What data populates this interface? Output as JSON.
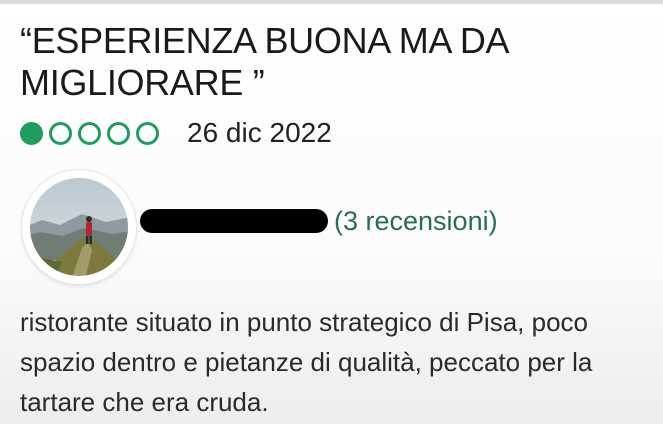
{
  "review": {
    "title": "“ESPERIENZA BUONA MA DA MIGLIORARE ”",
    "rating": {
      "value": 1,
      "max": 5,
      "color": "#1f9d5c"
    },
    "date": "26 dic 2022",
    "author": {
      "avatar_icon": "hiker-on-ridge-photo",
      "name_redacted": true,
      "review_count_label": "(3 recensioni)"
    },
    "text": "ristorante situato in punto strategico di Pisa, poco spazio dentro e pietanze di qualità, peccato per la tartare che era cruda."
  }
}
